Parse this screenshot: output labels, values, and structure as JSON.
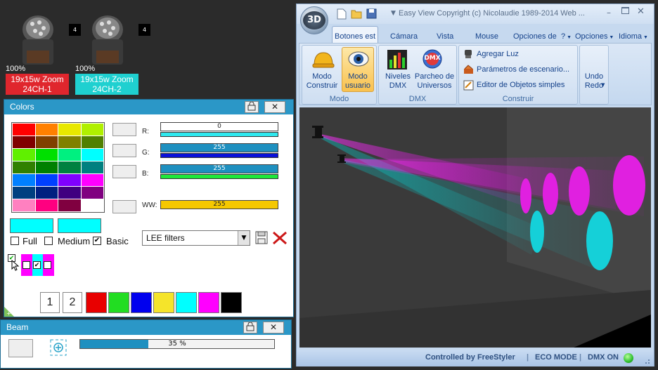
{
  "fixtures": [
    {
      "percent": "100%",
      "badge": "4",
      "name": "19x15w Zoom",
      "channel": "24CH-1",
      "label_color": "#e0262d"
    },
    {
      "percent": "100%",
      "badge": "4",
      "name": "19x15w Zoom",
      "channel": "24CH-2",
      "label_color": "#1fd0d0"
    }
  ],
  "colors_panel": {
    "title": "Colors",
    "channels": [
      {
        "label": "R:",
        "value": "0"
      },
      {
        "label": "G:",
        "value": "255"
      },
      {
        "label": "B:",
        "value": "255"
      },
      {
        "label": "WW:",
        "value": "255"
      }
    ],
    "filter_select": "LEE filters",
    "checkboxes": [
      {
        "label": "Full",
        "checked": false
      },
      {
        "label": "Medium",
        "checked": false
      },
      {
        "label": "Basic",
        "checked": true
      }
    ],
    "check_mark": "✔",
    "page_buttons": [
      "1",
      "2"
    ],
    "palette_colors": [
      "#e80000",
      "#22dd22",
      "#0000ee",
      "#f5e42a",
      "#00ffff",
      "#ff00ff",
      "#000000"
    ],
    "swatches": [
      "#ff0000",
      "#ff8000",
      "#e8e800",
      "#b0f000",
      "#800000",
      "#804000",
      "#808000",
      "#508000",
      "#60f000",
      "#00e000",
      "#00f080",
      "#00ffff",
      "#308000",
      "#008000",
      "#008040",
      "#008080",
      "#0080ff",
      "#0040ff",
      "#8000ff",
      "#ff00ff",
      "#004080",
      "#002080",
      "#400080",
      "#800080",
      "#ff80c0",
      "#ff0080",
      "#800040",
      "#ffffff"
    ]
  },
  "beam_panel": {
    "title": "Beam",
    "progress_text": "35 %",
    "progress_fraction": 0.35
  },
  "window": {
    "title": "Easy View   Copyright (c) Nicolaudie 1989-2014   Web ...",
    "tabs": [
      "Botones est",
      "Cámara",
      "Vista",
      "Mouse",
      "Opciones de",
      "?",
      "Opciones",
      "Idioma"
    ],
    "groups": {
      "modo": {
        "label": "Modo",
        "construir": "Modo\nConstruir",
        "usuario": "Modo\nusuario"
      },
      "dmx": {
        "label": "DMX",
        "niveles": "Niveles\nDMX",
        "parcheo": "Parcheo de\nUniversos"
      },
      "construir": {
        "label": "Construir",
        "items": [
          "Agregar Luz",
          "Parámetros de escenario...",
          "Editor de Objetos simples"
        ]
      },
      "undo": {
        "label": "Undo\nRedo"
      }
    },
    "status": {
      "controlled": "Controlled by FreeStyler",
      "eco": "ECO MODE",
      "dmx": "DMX ON"
    },
    "dmx_badge": "DMX",
    "logo": "3D"
  },
  "colors": {
    "title_bar": "#2b97c7",
    "cyan": "#00ffff",
    "magenta": "#ff00ff",
    "slider_fill": "#1e90c0",
    "amber": "#f5c800"
  }
}
